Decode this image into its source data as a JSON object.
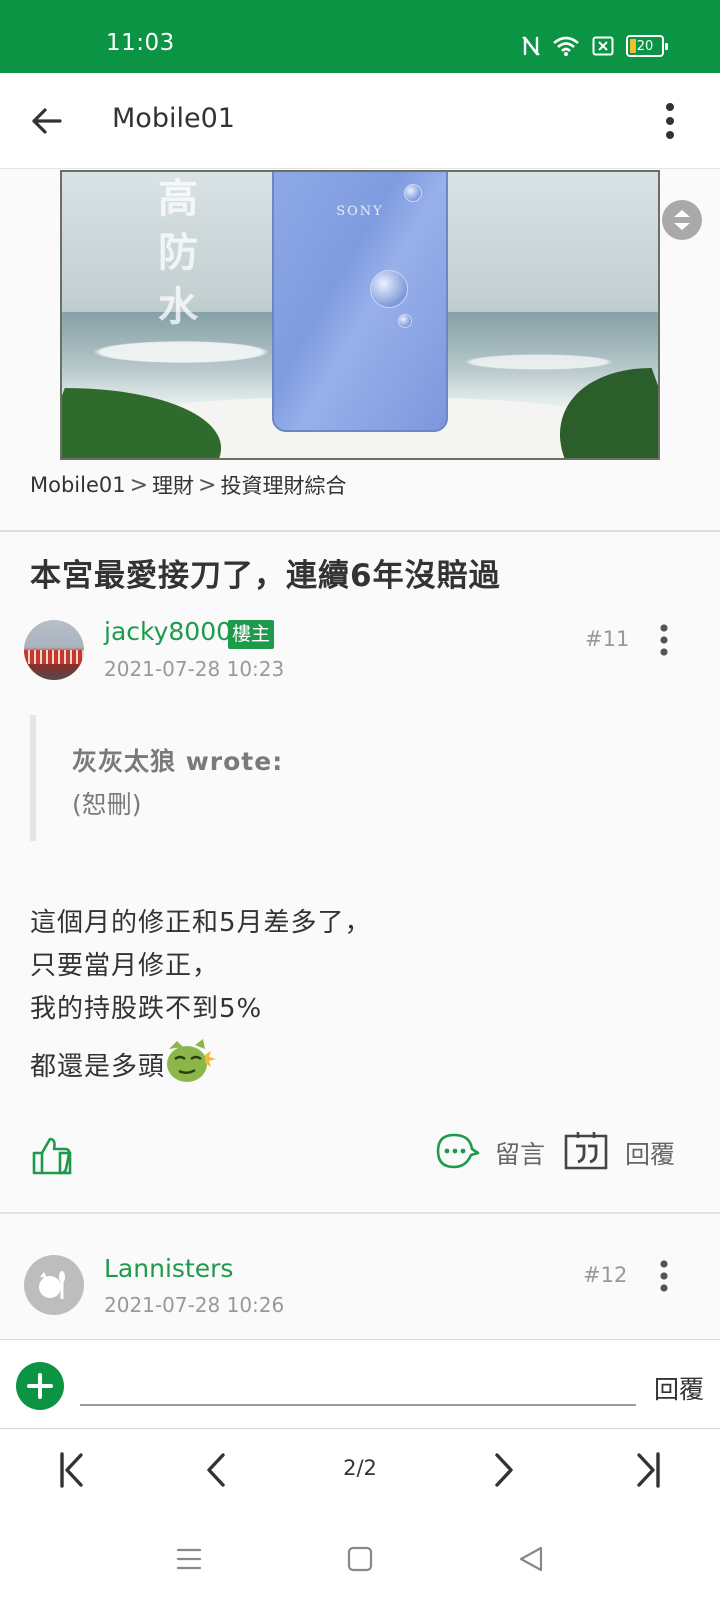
{
  "status_bar": {
    "time": "11:03",
    "battery": "20",
    "color": "#0a9444"
  },
  "app_bar": {
    "title": "Mobile01",
    "back_icon": "arrow-left-icon",
    "menu_icon": "more-vertical-icon"
  },
  "banner": {
    "brand": "SONY",
    "overlay_text": "高防水"
  },
  "breadcrumb": {
    "items": [
      "Mobile01",
      "理財",
      "投資理財綜合"
    ],
    "separator": ">"
  },
  "thread": {
    "title": "本宮最愛接刀了，連續6年沒賠過"
  },
  "post1": {
    "username": "jacky8000",
    "badge": "樓主",
    "timestamp": "2021-07-28 10:23",
    "floor": "#11",
    "quote": {
      "author": "灰灰太狼 wrote:",
      "text": "(恕刪)"
    },
    "body_lines": [
      "這個月的修正和5月差多了，",
      "只要當月修正，",
      "我的持股跌不到5%",
      "都還是多頭"
    ],
    "actions": {
      "comment_label": "留言",
      "reply_label": "回覆"
    }
  },
  "post2": {
    "username": "Lannisters",
    "timestamp": "2021-07-28 10:26",
    "floor": "#12"
  },
  "reply_bar": {
    "input_value": "",
    "submit_label": "回覆"
  },
  "pager": {
    "page_indicator": "2/2"
  },
  "colors": {
    "accent": "#0a9444",
    "username": "#1e9a4d",
    "muted": "#999999"
  }
}
